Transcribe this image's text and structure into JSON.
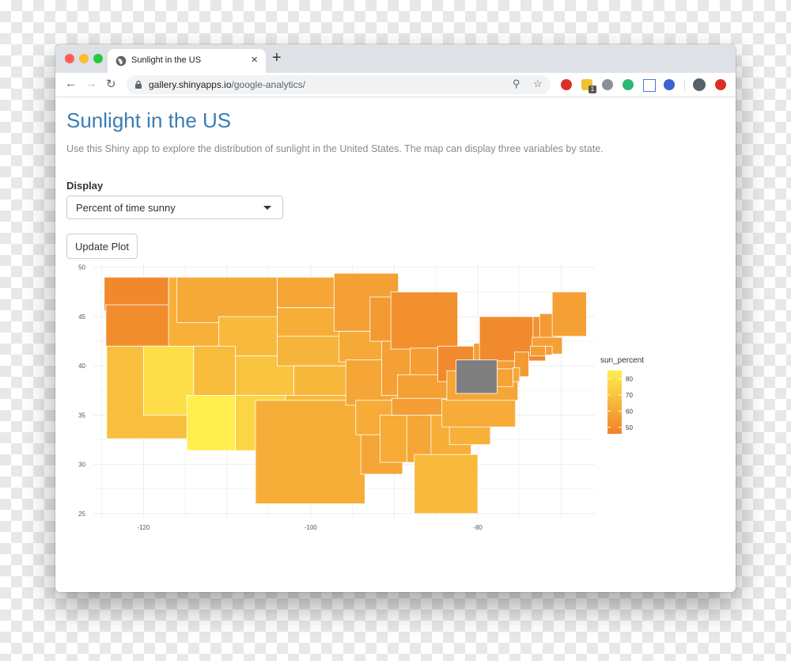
{
  "browser": {
    "tab_title": "Sunlight in the US",
    "tab_close": "×",
    "new_tab": "+",
    "url_host": "gallery.shinyapps.io",
    "url_path": "/google-analytics/",
    "extension_badge": "1"
  },
  "page": {
    "title": "Sunlight in the US",
    "description": "Use this Shiny app to explore the distribution of sunlight in the United States. The map can display three variables by state.",
    "display_label": "Display",
    "display_selected": "Percent of time sunny",
    "update_button": "Update Plot"
  },
  "icons": [
    "globe-icon",
    "back-arrow-icon",
    "forward-arrow-icon",
    "reload-icon",
    "lock-icon",
    "zoom-icon",
    "star-icon",
    "profile-avatar-icon"
  ],
  "colors": {
    "title": "#3b7cb3",
    "scale_high": "#ffee4d",
    "scale_low": "#f0822a",
    "missing": "#7f7f7f"
  },
  "chart_data": {
    "type": "choropleth",
    "x_ticks": [
      "-120",
      "-100",
      "-80"
    ],
    "y_ticks": [
      "50",
      "45",
      "40",
      "35",
      "30",
      "25"
    ],
    "xlim": [
      -126,
      -66
    ],
    "ylim": [
      24.5,
      50.3
    ],
    "legend_title": "sun_percent",
    "legend_ticks": [
      "80",
      "70",
      "60",
      "50"
    ],
    "legend_range": [
      46,
      85
    ],
    "legend_position": "right",
    "grid": true,
    "missing_states": [
      "WV"
    ],
    "states": [
      {
        "state": "WA",
        "sun_percent": 48
      },
      {
        "state": "OR",
        "sun_percent": 50
      },
      {
        "state": "CA",
        "sun_percent": 68
      },
      {
        "state": "NV",
        "sun_percent": 79
      },
      {
        "state": "ID",
        "sun_percent": 63
      },
      {
        "state": "MT",
        "sun_percent": 60
      },
      {
        "state": "WY",
        "sun_percent": 66
      },
      {
        "state": "UT",
        "sun_percent": 67
      },
      {
        "state": "AZ",
        "sun_percent": 85
      },
      {
        "state": "CO",
        "sun_percent": 70
      },
      {
        "state": "NM",
        "sun_percent": 76
      },
      {
        "state": "ND",
        "sun_percent": 59
      },
      {
        "state": "SD",
        "sun_percent": 62
      },
      {
        "state": "NE",
        "sun_percent": 64
      },
      {
        "state": "KS",
        "sun_percent": 65
      },
      {
        "state": "OK",
        "sun_percent": 66
      },
      {
        "state": "TX",
        "sun_percent": 62
      },
      {
        "state": "MN",
        "sun_percent": 57
      },
      {
        "state": "IA",
        "sun_percent": 60
      },
      {
        "state": "MO",
        "sun_percent": 59
      },
      {
        "state": "AR",
        "sun_percent": 61
      },
      {
        "state": "LA",
        "sun_percent": 59
      },
      {
        "state": "WI",
        "sun_percent": 55
      },
      {
        "state": "IL",
        "sun_percent": 57
      },
      {
        "state": "MS",
        "sun_percent": 61
      },
      {
        "state": "MI",
        "sun_percent": 51
      },
      {
        "state": "IN",
        "sun_percent": 56
      },
      {
        "state": "KY",
        "sun_percent": 57
      },
      {
        "state": "TN",
        "sun_percent": 56
      },
      {
        "state": "AL",
        "sun_percent": 59
      },
      {
        "state": "OH",
        "sun_percent": 49
      },
      {
        "state": "GA",
        "sun_percent": 62
      },
      {
        "state": "FL",
        "sun_percent": 66
      },
      {
        "state": "SC",
        "sun_percent": 63
      },
      {
        "state": "NC",
        "sun_percent": 61
      },
      {
        "state": "VA",
        "sun_percent": 59
      },
      {
        "state": "PA",
        "sun_percent": 56
      },
      {
        "state": "NY",
        "sun_percent": 49
      },
      {
        "state": "VT",
        "sun_percent": 52
      },
      {
        "state": "NH",
        "sun_percent": 55
      },
      {
        "state": "ME",
        "sun_percent": 57
      },
      {
        "state": "MA",
        "sun_percent": 57
      },
      {
        "state": "CT",
        "sun_percent": 56
      },
      {
        "state": "RI",
        "sun_percent": 57
      },
      {
        "state": "NJ",
        "sun_percent": 55
      },
      {
        "state": "DE",
        "sun_percent": 60
      },
      {
        "state": "MD",
        "sun_percent": 58
      }
    ]
  }
}
